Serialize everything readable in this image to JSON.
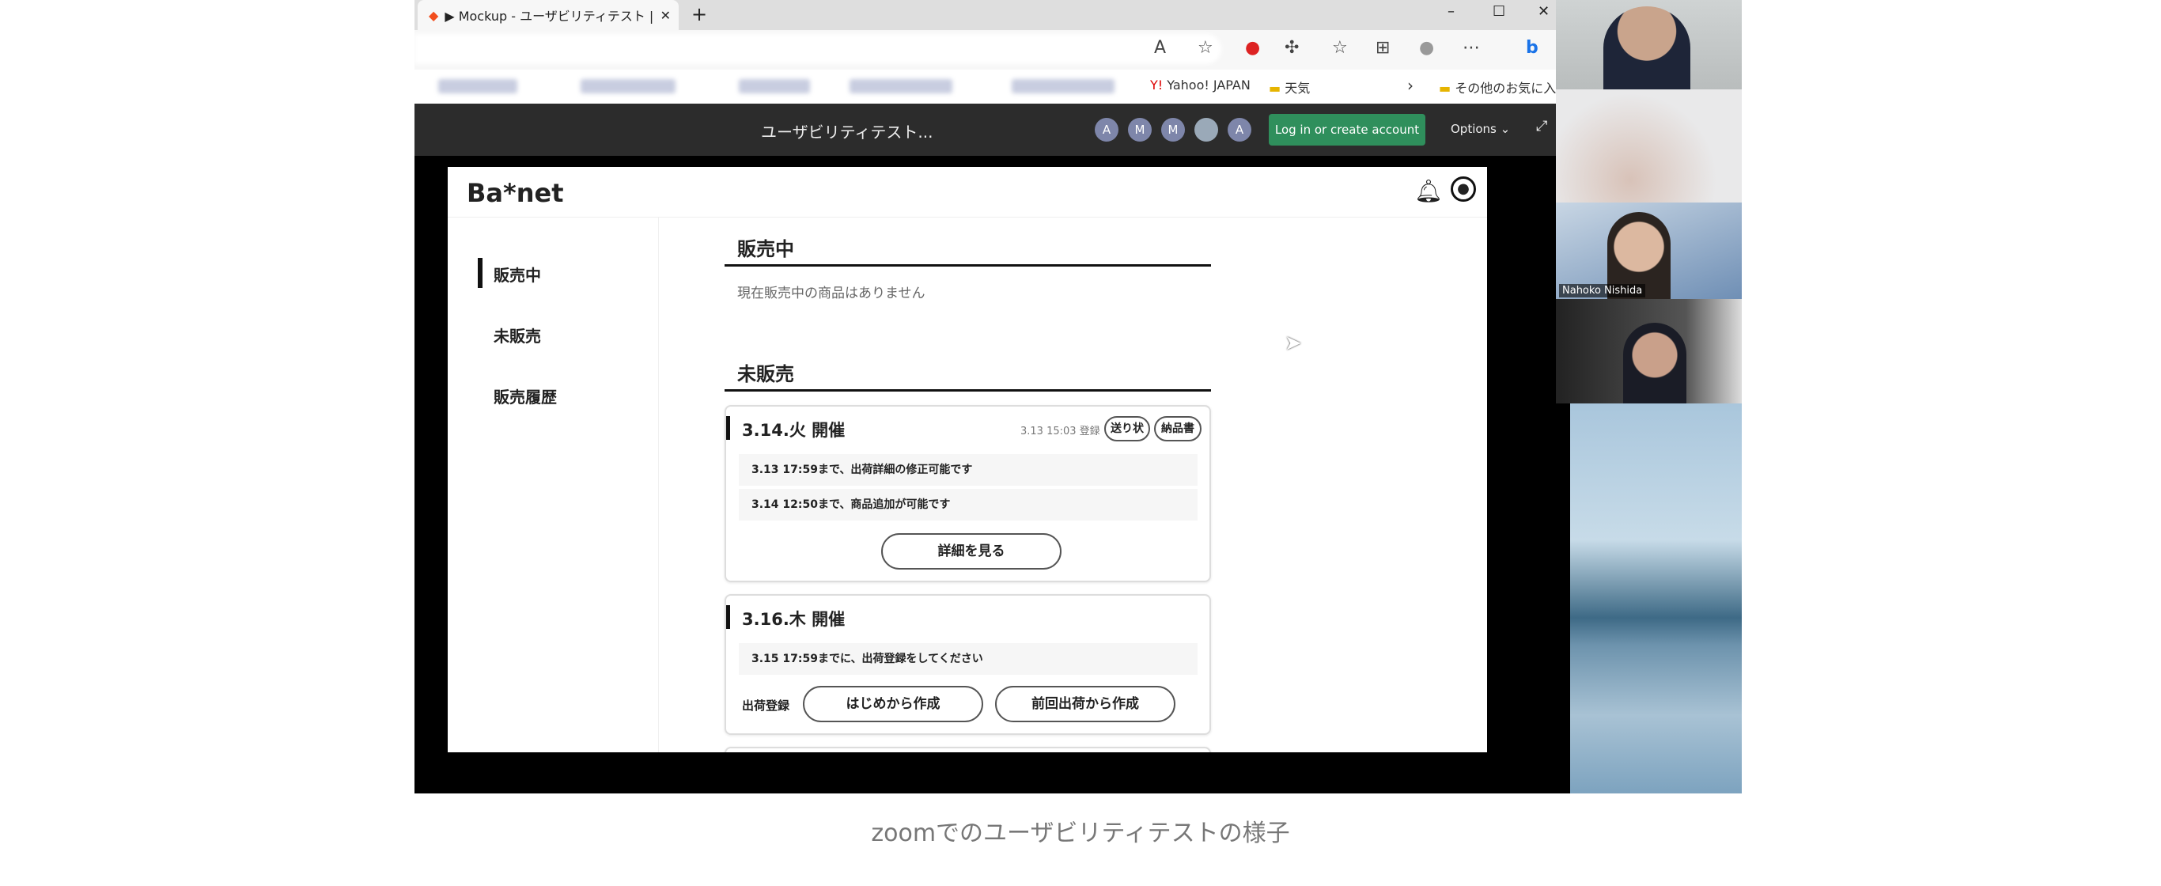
{
  "browser": {
    "tab_title": "▶ Mockup - ユーザビリティテスト |",
    "new_tab": "+",
    "window_controls": [
      "–",
      "☐",
      "✕"
    ],
    "bookmarks": [
      "Yahoo! JAPAN",
      "天気",
      "その他のお気に入り"
    ]
  },
  "figma": {
    "file_title": "ユーザビリティテスト...",
    "avatars": [
      "A",
      "M",
      "M",
      "",
      "A"
    ],
    "login_label": "Log in or create account",
    "options_label": "Options ⌄"
  },
  "app": {
    "logo": "Ba*net",
    "sidebar": [
      {
        "label": "販売中",
        "active": true
      },
      {
        "label": "未販売"
      },
      {
        "label": "販売履歴"
      }
    ],
    "section_selling": {
      "title": "販売中",
      "empty": "現在販売中の商品はありません"
    },
    "section_unsold": {
      "title": "未販売"
    },
    "cards": [
      {
        "title": "3.14.火 開催",
        "registered": "3.13 15:03 登録",
        "tags": [
          "送り状",
          "納品書"
        ],
        "notes": [
          "3.13 17:59まで、出荷詳細の修正可能です",
          "3.14 12:50まで、商品追加が可能です"
        ],
        "button": "詳細を見る"
      },
      {
        "title": "3.16.木 開催",
        "notes": [
          "3.15 17:59までに、出荷登録をしてください"
        ],
        "action_label": "出荷登録",
        "buttons": [
          "はじめから作成",
          "前回出荷から作成"
        ]
      }
    ]
  },
  "video": {
    "participants": [
      {
        "name": ""
      },
      {
        "name": ""
      },
      {
        "name": "Nahoko Nishida"
      },
      {
        "name": ""
      },
      {
        "name": ""
      }
    ]
  },
  "caption": "zoomでのユーザビリティテストの様子"
}
